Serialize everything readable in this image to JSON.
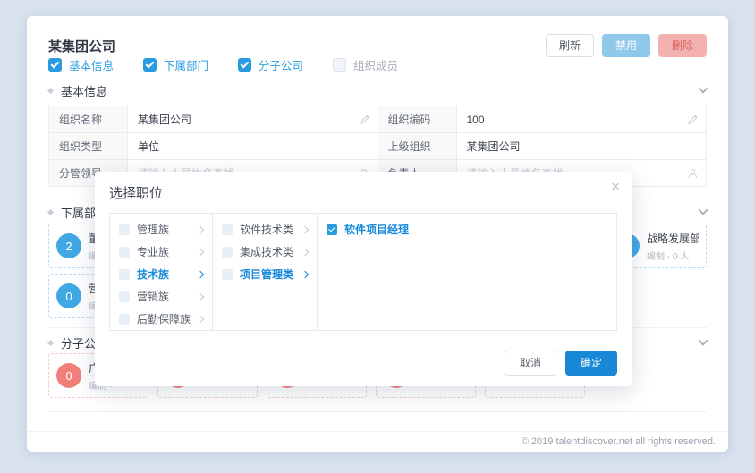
{
  "colors": {
    "accent": "#2b9be0",
    "confirm_button": "#1787d6",
    "disable_button": "#8fc8ea",
    "delete_button": "#f3b1af",
    "dept_circle": "#41a8e6",
    "subsidiary_circle": "#f37f7d"
  },
  "icons": [
    "refresh",
    "edit-pencil",
    "search-magnifier",
    "user-person",
    "chevron-down",
    "chevron-right",
    "close-x",
    "check",
    "diamond-bullet"
  ],
  "header": {
    "title": "某集团公司",
    "buttons": {
      "refresh": "刷新",
      "disable": "禁用",
      "delete": "删除"
    }
  },
  "filters": {
    "items": [
      {
        "label": "基本信息",
        "checked": true
      },
      {
        "label": "下属部门",
        "checked": true
      },
      {
        "label": "分子公司",
        "checked": true
      },
      {
        "label": "组织成员",
        "checked": false
      }
    ]
  },
  "basic": {
    "title": "基本信息",
    "rows": [
      {
        "label": "组织名称",
        "value": "某集团公司"
      },
      {
        "label": "组织编码",
        "value": "100"
      },
      {
        "label": "组织类型",
        "value": "单位"
      },
      {
        "label": "上级组织",
        "value": "某集团公司"
      },
      {
        "label": "分管领导",
        "placeholder": "请输入人员姓名查找"
      },
      {
        "label": "负责人",
        "placeholder": "请输入人员姓名查找"
      }
    ]
  },
  "departments": {
    "title": "下属部门",
    "cards": [
      {
        "count": "2",
        "name": "董事会",
        "meta": "编制 -"
      },
      {
        "count": "0",
        "name": "战略发展部",
        "meta": "编制 - 0 人"
      },
      {
        "count": "0",
        "name": "营销管理部",
        "meta": "编制 -"
      }
    ]
  },
  "subsidiaries": {
    "title": "分子公司",
    "cards": [
      {
        "count": "0",
        "name": "广州分公司",
        "meta": "编制 -"
      }
    ]
  },
  "modal": {
    "title": "选择职位",
    "close": "×",
    "columns": {
      "families": [
        {
          "label": "管理族",
          "selected": false
        },
        {
          "label": "专业族",
          "selected": false
        },
        {
          "label": "技术族",
          "selected": true
        },
        {
          "label": "营销族",
          "selected": false
        },
        {
          "label": "后勤保障族",
          "selected": false
        }
      ],
      "categories": [
        {
          "label": "软件技术类",
          "selected": false
        },
        {
          "label": "集成技术类",
          "selected": false
        },
        {
          "label": "项目管理类",
          "selected": true
        }
      ],
      "positions": [
        {
          "label": "软件项目经理",
          "checked": true
        }
      ]
    },
    "buttons": {
      "cancel": "取消",
      "confirm": "确定"
    }
  },
  "footer": {
    "copyright": "© 2019 talentdiscover.net all rights reserved."
  }
}
